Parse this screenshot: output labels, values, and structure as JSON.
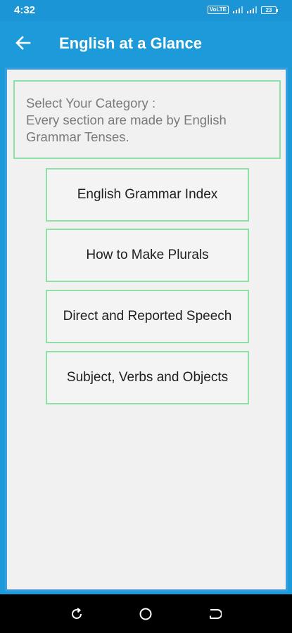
{
  "status_bar": {
    "time": "4:32",
    "volte": "VoLTE",
    "battery": "23"
  },
  "app_bar": {
    "title": "English at a Glance",
    "back_icon": "arrow-left-icon"
  },
  "info_box": {
    "line1": "Select Your Category :",
    "line2": "Every section are made by English",
    "line3": "Grammar Tenses."
  },
  "menu": {
    "items": [
      {
        "label": "English Grammar Index"
      },
      {
        "label": "How to Make Plurals"
      },
      {
        "label": "Direct and Reported Speech"
      },
      {
        "label": "Subject, Verbs and Objects"
      }
    ]
  },
  "nav_bar": {
    "icons": [
      "recent-apps-icon",
      "home-icon",
      "back-icon"
    ]
  },
  "colors": {
    "app_bar": "#1d9ad9",
    "frame_border": "#3a9ee0",
    "button_border": "#8fe0a7",
    "content_bg": "#f1f1f1"
  }
}
